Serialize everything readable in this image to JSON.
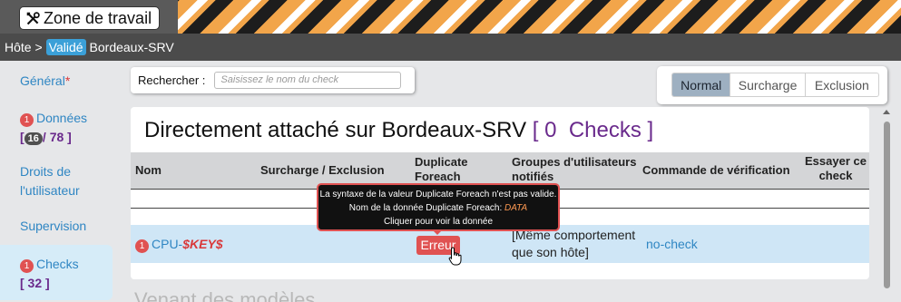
{
  "header": {
    "zone_label": "Zone de travail"
  },
  "breadcrumb": {
    "host": "Hôte >",
    "status": "Validé",
    "name": "Bordeaux-SRV"
  },
  "sidebar": {
    "general": {
      "label": "Général",
      "marker": "*"
    },
    "donnees": {
      "badge": "1",
      "label": "Données",
      "open": "[",
      "current": "16",
      "sep": "/",
      "total": "78",
      "close": "]"
    },
    "droits": {
      "label": "Droits de l'utilisateur"
    },
    "supervision": {
      "label": "Supervision"
    },
    "checks": {
      "badge": "1",
      "label": "Checks",
      "count": "[ 32 ]"
    }
  },
  "search": {
    "label": "Rechercher :",
    "placeholder": "Saisissez le nom du check"
  },
  "modes": [
    "Normal",
    "Surcharge",
    "Exclusion"
  ],
  "panel": {
    "title": "Directement attaché sur Bordeaux-SRV",
    "count_open": "[",
    "count": "0",
    "count_label": "Checks",
    "count_close": "]"
  },
  "table": {
    "headers": {
      "nom": "Nom",
      "surcharge": "Surcharge / Exclusion",
      "duplicate": "Duplicate Foreach",
      "groupes": "Groupes d'utilisateurs notifiés",
      "commande": "Commande de vérification",
      "essayer": "Essayer ce check"
    },
    "row": {
      "badge": "1",
      "name_prefix": "CPU-",
      "name_var": "$KEY$",
      "error_label": "Erreur",
      "groups": "[Même comportement que son hôte]",
      "command": "no-check"
    }
  },
  "tooltip": {
    "line1": "La syntaxe de la valeur Duplicate Foreach n'est pas valide.",
    "line2_prefix": "Nom de la donnée Duplicate Foreach: ",
    "line2_value": "DATA",
    "line3": "Cliquer pour voir la donnée"
  },
  "next_section": {
    "title": "Venant des modèles"
  }
}
